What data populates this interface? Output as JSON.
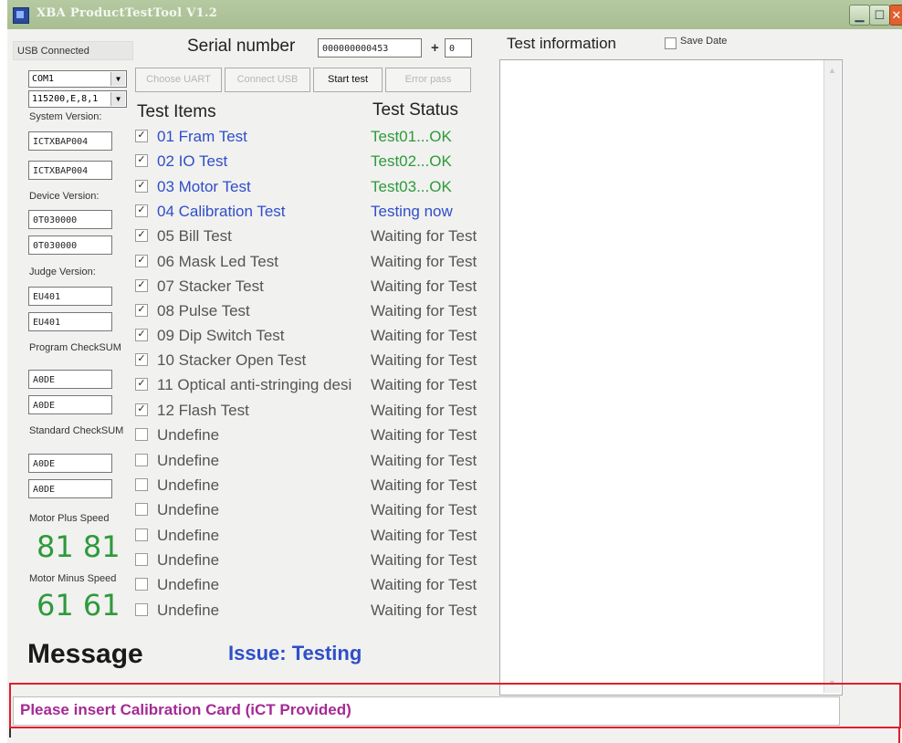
{
  "window": {
    "title": "XBA ProductTestTool V1.2"
  },
  "left": {
    "usb_status": "USB Connected",
    "com_port": "COM1",
    "baud": "115200,E,8,1",
    "system_version_label": "System Version:",
    "system_version_1": "ICTXBAP004",
    "system_version_2": "ICTXBAP004",
    "device_version_label": "Device Version:",
    "device_version_1": "0T030000",
    "device_version_2": "0T030000",
    "judge_version_label": "Judge Version:",
    "judge_version_1": "EU401",
    "judge_version_2": "EU401",
    "program_checksum_label": "Program CheckSUM",
    "program_checksum_1": "A0DE",
    "program_checksum_2": "A0DE",
    "standard_checksum_label": "Standard CheckSUM",
    "standard_checksum_1": "A0DE",
    "standard_checksum_2": "A0DE",
    "motor_plus_label": "Motor Plus Speed",
    "motor_plus_value": "81 81",
    "motor_minus_label": "Motor Minus Speed",
    "motor_minus_value": "61 61"
  },
  "serial": {
    "label": "Serial number",
    "value": "000000000453",
    "plus": "+",
    "increment": "0"
  },
  "toolbar": {
    "choose_uart": "Choose UART",
    "connect_usb": "Connect USB",
    "start_test": "Start test",
    "error_pass": "Error pass"
  },
  "tests": {
    "items_header": "Test Items",
    "status_header": "Test Status",
    "rows": [
      {
        "label": "01 Fram Test",
        "status": "Test01...OK"
      },
      {
        "label": "02 IO Test",
        "status": "Test02...OK"
      },
      {
        "label": "03 Motor Test",
        "status": "Test03...OK"
      },
      {
        "label": "04 Calibration Test",
        "status": "Testing now"
      },
      {
        "label": "05 Bill Test",
        "status": "Waiting for Test"
      },
      {
        "label": "06 Mask Led Test",
        "status": "Waiting for Test"
      },
      {
        "label": "07 Stacker Test",
        "status": "Waiting for Test"
      },
      {
        "label": "08 Pulse Test",
        "status": "Waiting for Test"
      },
      {
        "label": "09 Dip Switch Test",
        "status": "Waiting for Test"
      },
      {
        "label": "10 Stacker Open Test",
        "status": "Waiting for Test"
      },
      {
        "label": "11 Optical anti-stringing desi",
        "status": "Waiting for Test"
      },
      {
        "label": "12 Flash Test",
        "status": "Waiting for Test"
      },
      {
        "label": "Undefine",
        "status": "Waiting for Test"
      },
      {
        "label": "Undefine",
        "status": "Waiting for Test"
      },
      {
        "label": "Undefine",
        "status": "Waiting for Test"
      },
      {
        "label": "Undefine",
        "status": "Waiting for Test"
      },
      {
        "label": "Undefine",
        "status": "Waiting for Test"
      },
      {
        "label": "Undefine",
        "status": "Waiting for Test"
      },
      {
        "label": "Undefine",
        "status": "Waiting for Test"
      },
      {
        "label": "Undefine",
        "status": "Waiting for Test"
      }
    ]
  },
  "info": {
    "title": "Test information",
    "save_date_label": "Save Date"
  },
  "bottom": {
    "message_label": "Message",
    "issue_text": "Issue: Testing",
    "message_text": "Please insert Calibration Card (iCT Provided)"
  },
  "colors": {
    "ok_green": "#2e9a3c",
    "blue": "#2f4ec9",
    "waiting_gray": "#555555",
    "message_purple": "#a42a94",
    "highlight_red": "#e01e2a"
  }
}
